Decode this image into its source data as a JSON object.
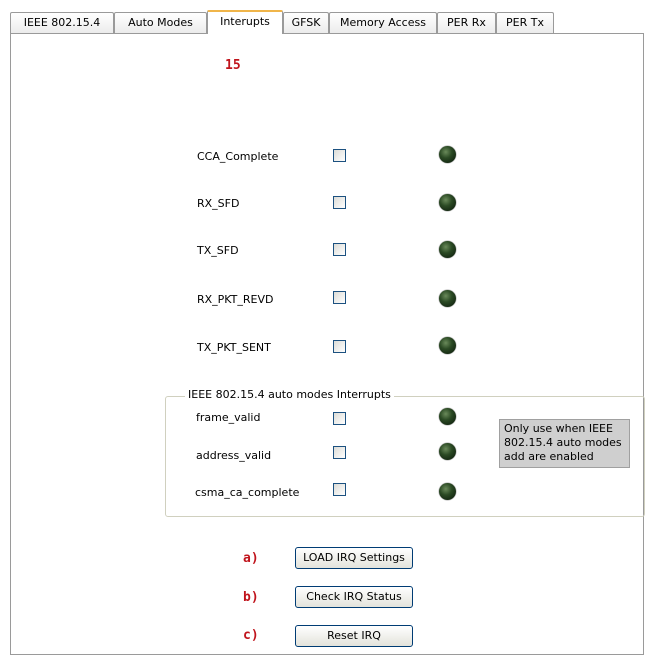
{
  "tabs": [
    {
      "label": "IEEE 802.15.4"
    },
    {
      "label": "Auto Modes"
    },
    {
      "label": "Interupts"
    },
    {
      "label": "GFSK"
    },
    {
      "label": "Memory Access"
    },
    {
      "label": "PER Rx"
    },
    {
      "label": "PER Tx"
    }
  ],
  "active_tab": "Interupts",
  "annotation_top": "15",
  "interrupts": [
    {
      "label": "CCA_Complete",
      "checked": false
    },
    {
      "label": "RX_SFD",
      "checked": false
    },
    {
      "label": "TX_SFD",
      "checked": false
    },
    {
      "label": "RX_PKT_REVD",
      "checked": false
    },
    {
      "label": "TX_PKT_SENT",
      "checked": false
    }
  ],
  "auto_group": {
    "title": "IEEE 802.15.4 auto modes Interrupts",
    "items": [
      {
        "label": "frame_valid",
        "checked": false
      },
      {
        "label": "address_valid",
        "checked": false
      },
      {
        "label": "csma_ca_complete",
        "checked": false
      }
    ],
    "note_lines": [
      "Only use when IEEE",
      "802.15.4 auto modes",
      "add are enabled"
    ]
  },
  "buttons": [
    {
      "annotation": "a)",
      "label": "LOAD IRQ Settings"
    },
    {
      "annotation": "b)",
      "label": "Check IRQ Status"
    },
    {
      "annotation": "c)",
      "label": "Reset IRQ"
    }
  ],
  "colors": {
    "led_off": "#1f3a1a",
    "annotation": "#c0141c",
    "active_tab_accent": "#f0b54a"
  }
}
